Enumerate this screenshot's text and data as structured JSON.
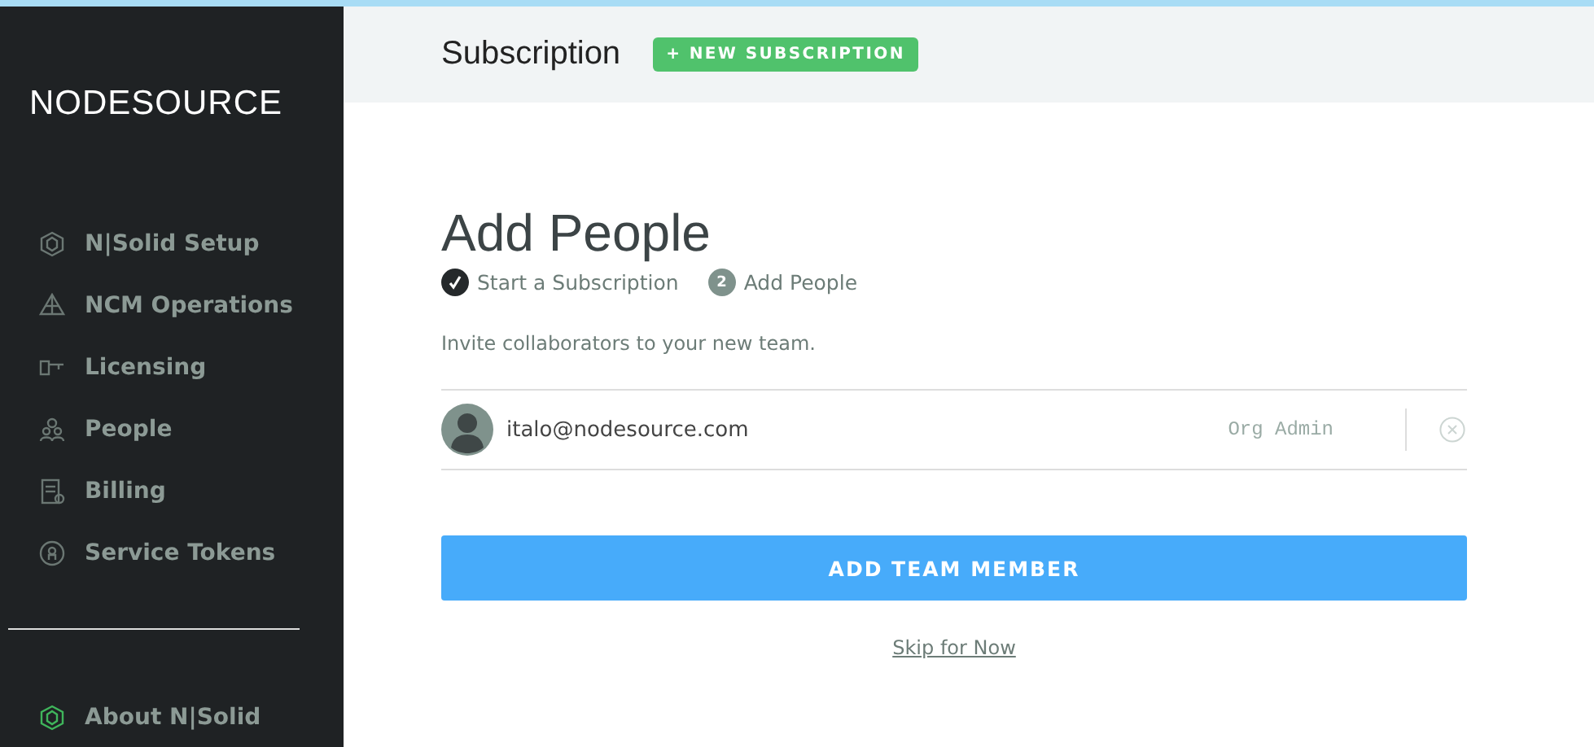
{
  "sidebar": {
    "logo": "NODESOURCE",
    "items": [
      {
        "label": "N|Solid Setup",
        "kind": "cube"
      },
      {
        "label": "NCM Operations",
        "kind": "pyramid"
      },
      {
        "label": "Licensing",
        "kind": "key"
      },
      {
        "label": "People",
        "kind": "people"
      },
      {
        "label": "Billing",
        "kind": "bill"
      },
      {
        "label": "Service Tokens",
        "kind": "token"
      }
    ],
    "footer_items": [
      {
        "label": "About N|Solid",
        "kind": "cube",
        "color": "#3fb55b"
      }
    ]
  },
  "header": {
    "title": "Subscription",
    "button": "+ NEW SUBSCRIPTION"
  },
  "page": {
    "title": "Add People",
    "steps": [
      {
        "label": "Start a Subscription",
        "done": true
      },
      {
        "label": "Add People",
        "done": false,
        "number": "2"
      }
    ],
    "intro": "Invite collaborators to your new team.",
    "members": [
      {
        "email": "italo@nodesource.com",
        "role": "Org Admin"
      }
    ],
    "add_button": "ADD TEAM MEMBER",
    "skip_link": "Skip for Now"
  }
}
